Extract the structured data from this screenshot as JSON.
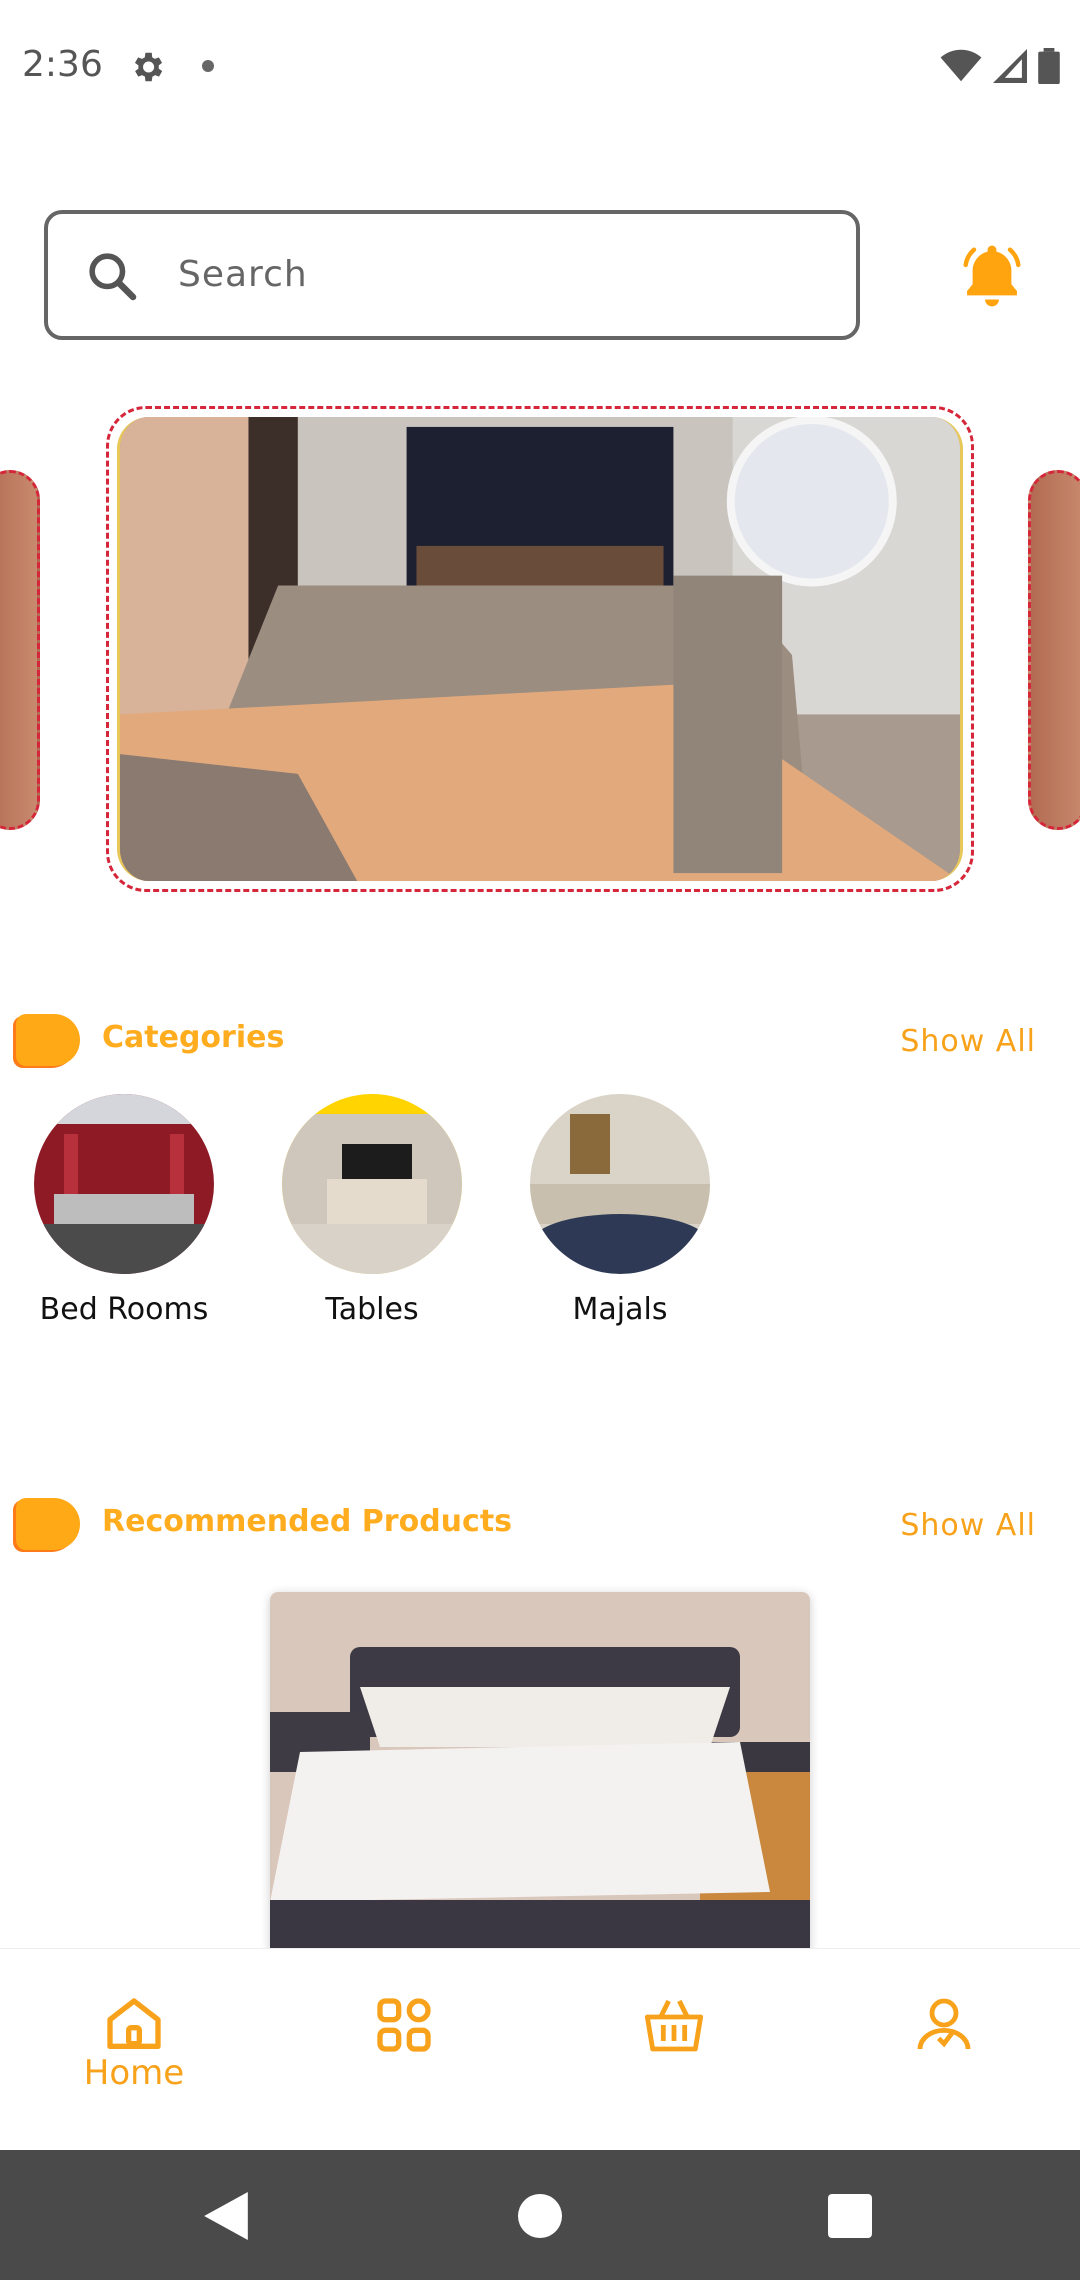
{
  "status_bar": {
    "time": "2:36"
  },
  "search": {
    "placeholder": "Search",
    "value": ""
  },
  "sections": {
    "categories": {
      "title": "Categories",
      "show_all": "Show All"
    },
    "recommended": {
      "title": "Recommended Products",
      "show_all": "Show All"
    }
  },
  "categories": [
    {
      "label": "Bed Rooms"
    },
    {
      "label": "Tables"
    },
    {
      "label": "Majals"
    }
  ],
  "bottom_nav": {
    "home_label": "Home",
    "items": [
      "home-icon",
      "grid-icon",
      "basket-icon",
      "user-icon"
    ]
  },
  "colors": {
    "accent": "#f7a21a",
    "carousel_border": "#d5263a",
    "system_nav": "#4a4a4a"
  }
}
